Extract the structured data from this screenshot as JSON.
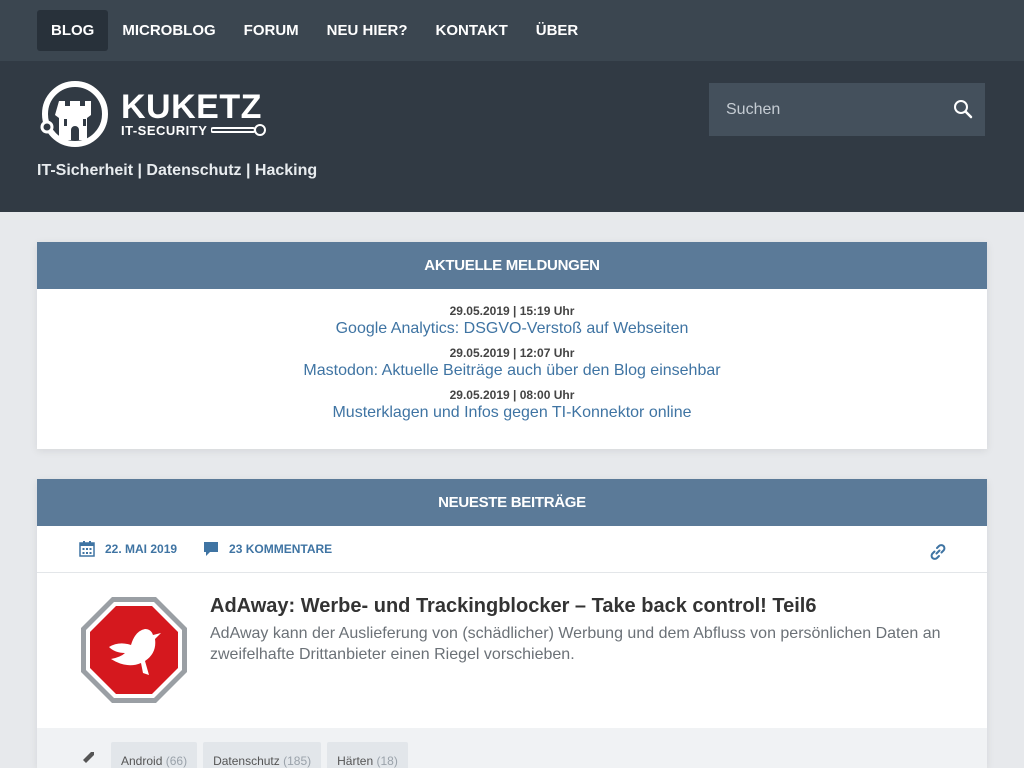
{
  "nav": {
    "items": [
      {
        "label": "BLOG",
        "active": true
      },
      {
        "label": "MICROBLOG",
        "active": false
      },
      {
        "label": "FORUM",
        "active": false
      },
      {
        "label": "NEU HIER?",
        "active": false
      },
      {
        "label": "KONTAKT",
        "active": false
      },
      {
        "label": "ÜBER",
        "active": false
      }
    ]
  },
  "header": {
    "logo_title": "KUKETZ",
    "logo_sub": "IT-SECURITY",
    "tagline": "IT-Sicherheit | Datenschutz | Hacking",
    "search_placeholder": "Suchen",
    "search_icon": "magnifier-icon"
  },
  "news": {
    "heading": "AKTUELLE MELDUNGEN",
    "items": [
      {
        "date": "29.05.2019 | 15:19 Uhr",
        "title": "Google Analytics: DSGVO-Verstoß auf Webseiten"
      },
      {
        "date": "29.05.2019 | 12:07 Uhr",
        "title": "Mastodon: Aktuelle Beiträge auch über den Blog einsehbar"
      },
      {
        "date": "29.05.2019 | 08:00 Uhr",
        "title": "Musterklagen und Infos gegen TI-Konnektor online"
      }
    ]
  },
  "posts": {
    "heading": "NEUESTE BEITRÄGE",
    "date": "22. MAI 2019",
    "comments": "23 KOMMENTARE",
    "title": "AdAway: Werbe- und Trackingblocker – Take back control! Teil6",
    "excerpt": "AdAway kann der Auslieferung von (schädlicher) Werbung und dem Abfluss von persönlichen Daten an zweifelhafte Drittanbieter einen Riegel vorschieben.",
    "tags": [
      {
        "label": "Android",
        "count": "(66)"
      },
      {
        "label": "Datenschutz",
        "count": "(185)"
      },
      {
        "label": "Härten",
        "count": "(18)"
      }
    ]
  },
  "colors": {
    "nav_bg": "#3b4650",
    "header_bg": "#313a44",
    "panel_head": "#5b7a98",
    "link": "#3f74a3"
  }
}
